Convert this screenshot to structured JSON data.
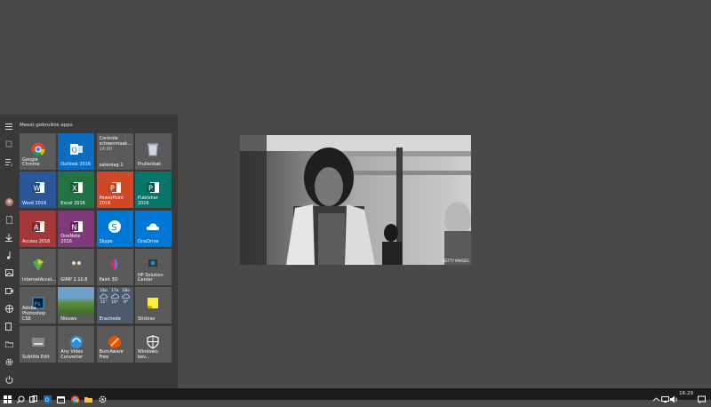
{
  "start_menu": {
    "section_title": "Meest gebruikte apps",
    "tiles": [
      {
        "label": "Google Chrome",
        "color": "#5a5a5a",
        "icon": "chrome-icon"
      },
      {
        "label": "Outlook 2016",
        "color": "#0a6dc2",
        "icon": "outlook-icon"
      },
      {
        "label": "Controle schoenmaak... 14:00 zaterdag 2",
        "color": "#5a5a5a",
        "icon": "calendar-event"
      },
      {
        "label": "Prullenbak",
        "color": "#5a5a5a",
        "icon": "recycle-bin-icon"
      },
      {
        "label": "Word 2016",
        "color": "#2b579a",
        "icon": "word-icon"
      },
      {
        "label": "Excel 2016",
        "color": "#217346",
        "icon": "excel-icon"
      },
      {
        "label": "PowerPoint 2016",
        "color": "#d24726",
        "icon": "powerpoint-icon"
      },
      {
        "label": "Publisher 2016",
        "color": "#077568",
        "icon": "publisher-icon"
      },
      {
        "label": "Access 2016",
        "color": "#a4373a",
        "icon": "access-icon"
      },
      {
        "label": "OneNote 2016",
        "color": "#80397b",
        "icon": "onenote-icon"
      },
      {
        "label": "Skype",
        "color": "#0078d7",
        "icon": "skype-icon"
      },
      {
        "label": "OneDrive",
        "color": "#0078d7",
        "icon": "onedrive-icon"
      },
      {
        "label": "InternetAccel...",
        "color": "#5a5a5a",
        "icon": "internet-accelerator-icon"
      },
      {
        "label": "GIMP 2.10.8",
        "color": "#5a5a5a",
        "icon": "gimp-icon"
      },
      {
        "label": "Paint 3D",
        "color": "#5a5a5a",
        "icon": "paint3d-icon"
      },
      {
        "label": "HP Solution Center",
        "color": "#5a5a5a",
        "icon": "hp-icon"
      },
      {
        "label": "Adobe Photoshop CS6",
        "color": "#5a5a5a",
        "icon": "photoshop-icon"
      },
      {
        "label": "Nieuws",
        "color": "#5a5a5a",
        "icon": "news-icon"
      },
      {
        "label": "Enschede",
        "color": "#5a5a5a",
        "icon": "weather-icon"
      },
      {
        "label": "Stickies",
        "color": "#5a5a5a",
        "icon": "stickies-icon"
      },
      {
        "label": "Subtitle Edit",
        "color": "#5a5a5a",
        "icon": "subtitle-edit-icon"
      },
      {
        "label": "Any Video Converter",
        "color": "#5a5a5a",
        "icon": "video-converter-icon"
      },
      {
        "label": "BurnAware Free",
        "color": "#5a5a5a",
        "icon": "burnaware-icon"
      },
      {
        "label": "Windows-bev...",
        "color": "#5a5a5a",
        "icon": "shield-icon"
      }
    ],
    "weather": {
      "days": [
        "16o",
        "17o",
        "18o"
      ],
      "temps": [
        "11°",
        "10°",
        "9°"
      ]
    },
    "calendar_tile": {
      "line1": "Controle",
      "line2": "schoenmaak...",
      "line3": "14:00",
      "line4": "zaterdag 2"
    }
  },
  "photo": {
    "watermark": "GETTY IMAGES"
  },
  "taskbar": {
    "clock": "16:29",
    "icons": [
      "start-icon",
      "search-icon",
      "task-view-icon",
      "outlook-icon",
      "calendar-icon",
      "chrome-icon",
      "file-explorer-icon",
      "folder-icon",
      "settings-icon"
    ]
  }
}
